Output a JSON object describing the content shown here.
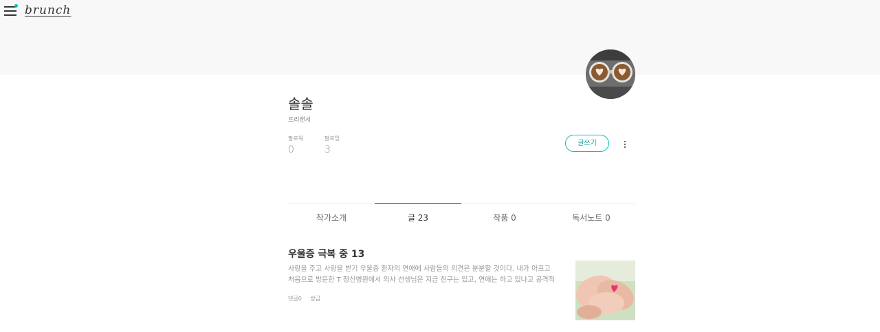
{
  "header": {
    "logo": "brunch",
    "menu_icon": "hamburger-menu-icon"
  },
  "profile": {
    "name": "솔솔",
    "job": "프리랜서",
    "followers_label": "팔로워",
    "followers_count": "0",
    "following_label": "팔로잉",
    "following_count": "3",
    "write_button": "글쓰기"
  },
  "tabs": [
    {
      "label": "작가소개",
      "active": false
    },
    {
      "label": "글 23",
      "active": true
    },
    {
      "label": "작품 0",
      "active": false
    },
    {
      "label": "독서노트 0",
      "active": false
    }
  ],
  "article": {
    "title": "우울증 극복 중 13",
    "line1": "사랑을 주고 사랑을 받기  우울증 환자의 연애에 사람들의 의견은 분분할 것이다. 내가 아프고",
    "line2": "처음으로 방문한 T 정신병원에서 의사 선생님은 지금 친구는 있고, 연애는 하고 있냐고 공격적",
    "comments": "댓글0",
    "time": "방금"
  },
  "colors": {
    "accent": "#00c3bd",
    "header_bg": "#f8f8f8"
  }
}
